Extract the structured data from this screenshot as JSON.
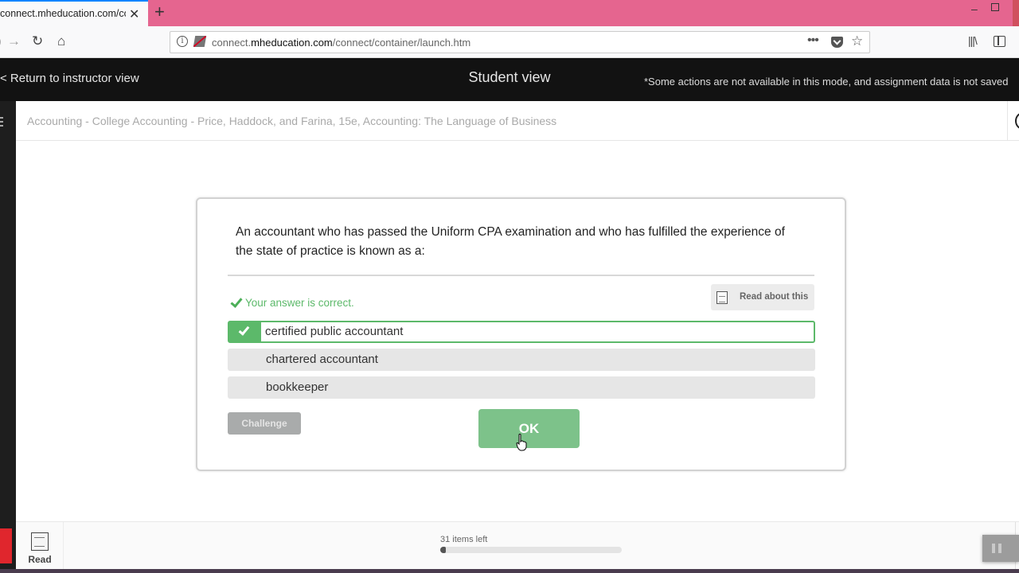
{
  "browser": {
    "tab_title": "connect.mheducation.com/connect/container/launch.htm",
    "url_domain_prefix": "connect.",
    "url_domain": "mheducation.com",
    "url_path": "/connect/container/launch.htm",
    "new_tab_symbol": "+",
    "tab_close_symbol": "✕",
    "icons": [
      "back-icon",
      "forward-icon",
      "reload-icon",
      "home-icon",
      "info-icon",
      "insecure-lock-icon",
      "more-icon",
      "pocket-icon",
      "bookmark-star-icon",
      "library-icon",
      "sidebar-icon"
    ],
    "minimize_symbol": "–"
  },
  "topbar": {
    "return_label": "< Return to instructor view",
    "title": "Student view",
    "notice": "*Some actions are not available in this mode, and assignment data is not saved"
  },
  "course": {
    "title": "Accounting - College Accounting - Price, Haddock, and Farina, 15e, Accounting: The Language of Business"
  },
  "question": {
    "text": "An accountant who has passed the Uniform CPA examination and who has fulfilled the experience of the state of practice is known as a:",
    "feedback": "Your answer is correct.",
    "read_about_label": "Read about this",
    "options": [
      {
        "label": "certified public accountant",
        "state": "correct-selected"
      },
      {
        "label": "chartered accountant",
        "state": "unselected"
      },
      {
        "label": "bookkeeper",
        "state": "unselected"
      }
    ],
    "challenge_label": "Challenge",
    "ok_label": "OK",
    "accent_color": "#5cb96a"
  },
  "bottombar": {
    "read_label": "Read",
    "items_left": "31 items left",
    "progress_fraction": 0.03
  }
}
